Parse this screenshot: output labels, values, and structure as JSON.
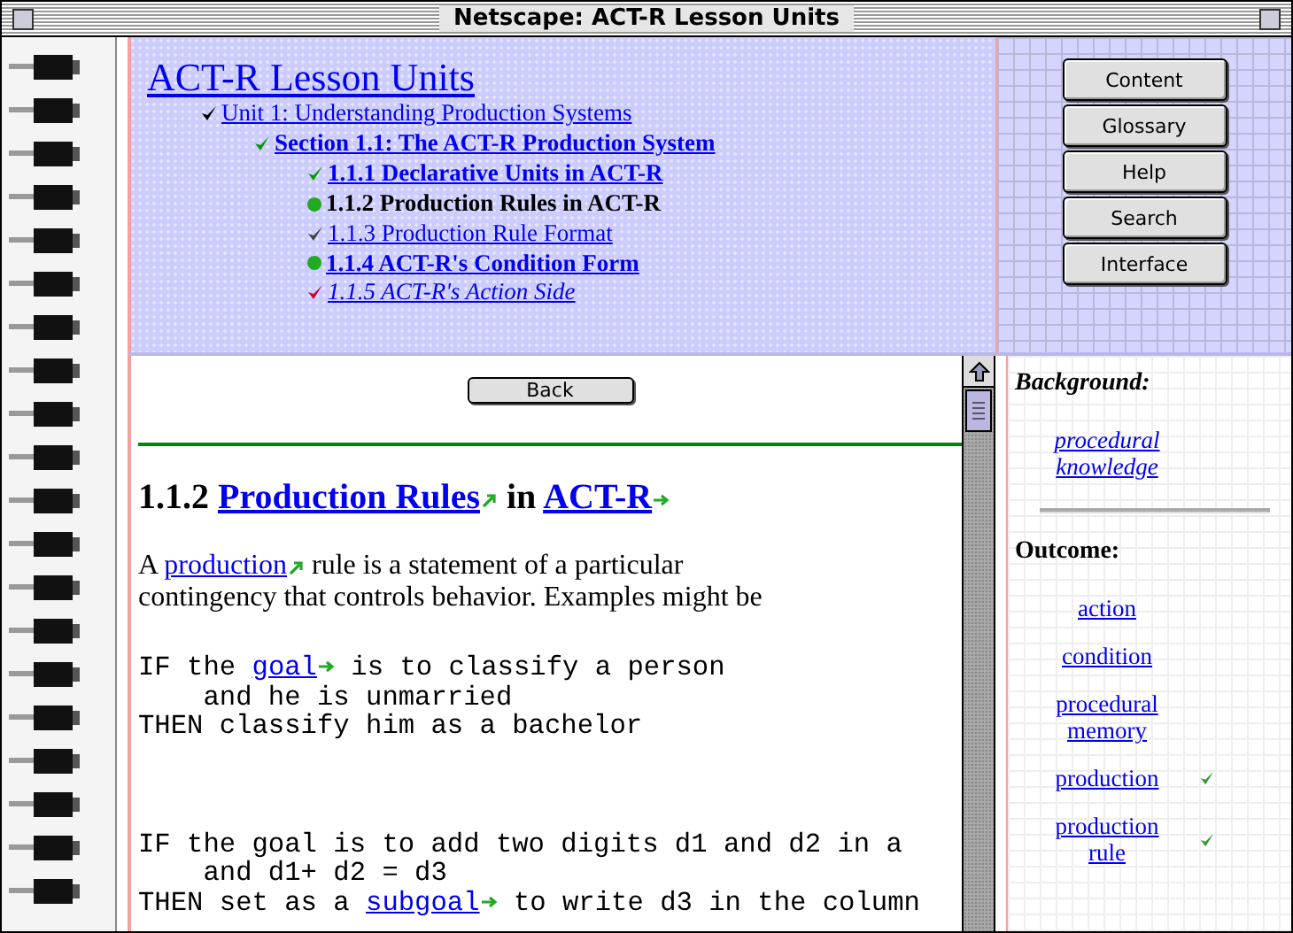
{
  "window": {
    "title": "Netscape: ACT-R Lesson Units"
  },
  "contents": {
    "title": "ACT-R Lesson Units",
    "outline": [
      {
        "label": "Unit 1: Understanding Production Systems",
        "kind": "check-plain",
        "color": "#000000",
        "selected": false,
        "children": [
          {
            "label": "Section 1.1: The ACT-R Production System",
            "kind": "check-bold",
            "color": "#009900",
            "selected": false,
            "children": [
              {
                "label": "1.1.1 Declarative Units in ACT-R",
                "kind": "check-bold",
                "color": "#009900",
                "selected": false
              },
              {
                "label": "1.1.2 Production Rules in ACT-R",
                "kind": "dot-bold",
                "color": "#22aa22",
                "selected": true
              },
              {
                "label": "1.1.3 Production Rule Format",
                "kind": "check-plain",
                "color": "#444444",
                "selected": false
              },
              {
                "label": "1.1.4 ACT-R's Condition Form",
                "kind": "dot-bold",
                "color": "#22aa22",
                "selected": false
              },
              {
                "label": "1.1.5 ACT-R's Action Side",
                "kind": "check-italic",
                "color": "#cc0033",
                "selected": false
              }
            ]
          }
        ]
      }
    ]
  },
  "nav_buttons": [
    "Content",
    "Glossary",
    "Help",
    "Search",
    "Interface"
  ],
  "lesson": {
    "back_button": "Back",
    "heading": [
      {
        "text": "1.1.2 ",
        "kind": "text"
      },
      {
        "text": "Production Rules",
        "kind": "link-diagonal"
      },
      {
        "text": " in ",
        "kind": "text"
      },
      {
        "text": "ACT-R",
        "kind": "link-right"
      }
    ],
    "paragraph": [
      [
        {
          "text": "A ",
          "kind": "text"
        },
        {
          "text": "production",
          "kind": "link-diagonal"
        },
        {
          "text": " rule is a statement of a particular",
          "kind": "text"
        }
      ],
      [
        {
          "text": "contingency that controls behavior.  Examples might be",
          "kind": "text"
        }
      ]
    ],
    "code_blocks": [
      [
        [
          {
            "text": "IF the ",
            "kind": "text"
          },
          {
            "text": "goal",
            "kind": "link-right"
          },
          {
            "text": " is to classify a person",
            "kind": "text"
          }
        ],
        [
          {
            "text": "    and he is unmarried",
            "kind": "text"
          }
        ],
        [
          {
            "text": "THEN classify him as a bachelor",
            "kind": "text"
          }
        ]
      ],
      [
        [
          {
            "text": "IF the goal is to add two digits d1 and d2 in a",
            "kind": "text"
          }
        ],
        [
          {
            "text": "    and d1+ d2 = d3",
            "kind": "text"
          }
        ],
        [
          {
            "text": "THEN set as a ",
            "kind": "text"
          },
          {
            "text": "subgoal",
            "kind": "link-right"
          },
          {
            "text": " to write d3 in the column",
            "kind": "text"
          }
        ]
      ]
    ]
  },
  "sidebar": {
    "background": {
      "heading": "Background:",
      "links": [
        {
          "label": "procedural knowledge",
          "checked": false
        }
      ]
    },
    "outcome": {
      "heading": "Outcome:",
      "links": [
        {
          "label": "action",
          "checked": false
        },
        {
          "label": "condition",
          "checked": false
        },
        {
          "label": "procedural memory",
          "checked": false
        },
        {
          "label": "production",
          "checked": true
        },
        {
          "label": "production rule",
          "checked": true
        }
      ]
    }
  }
}
